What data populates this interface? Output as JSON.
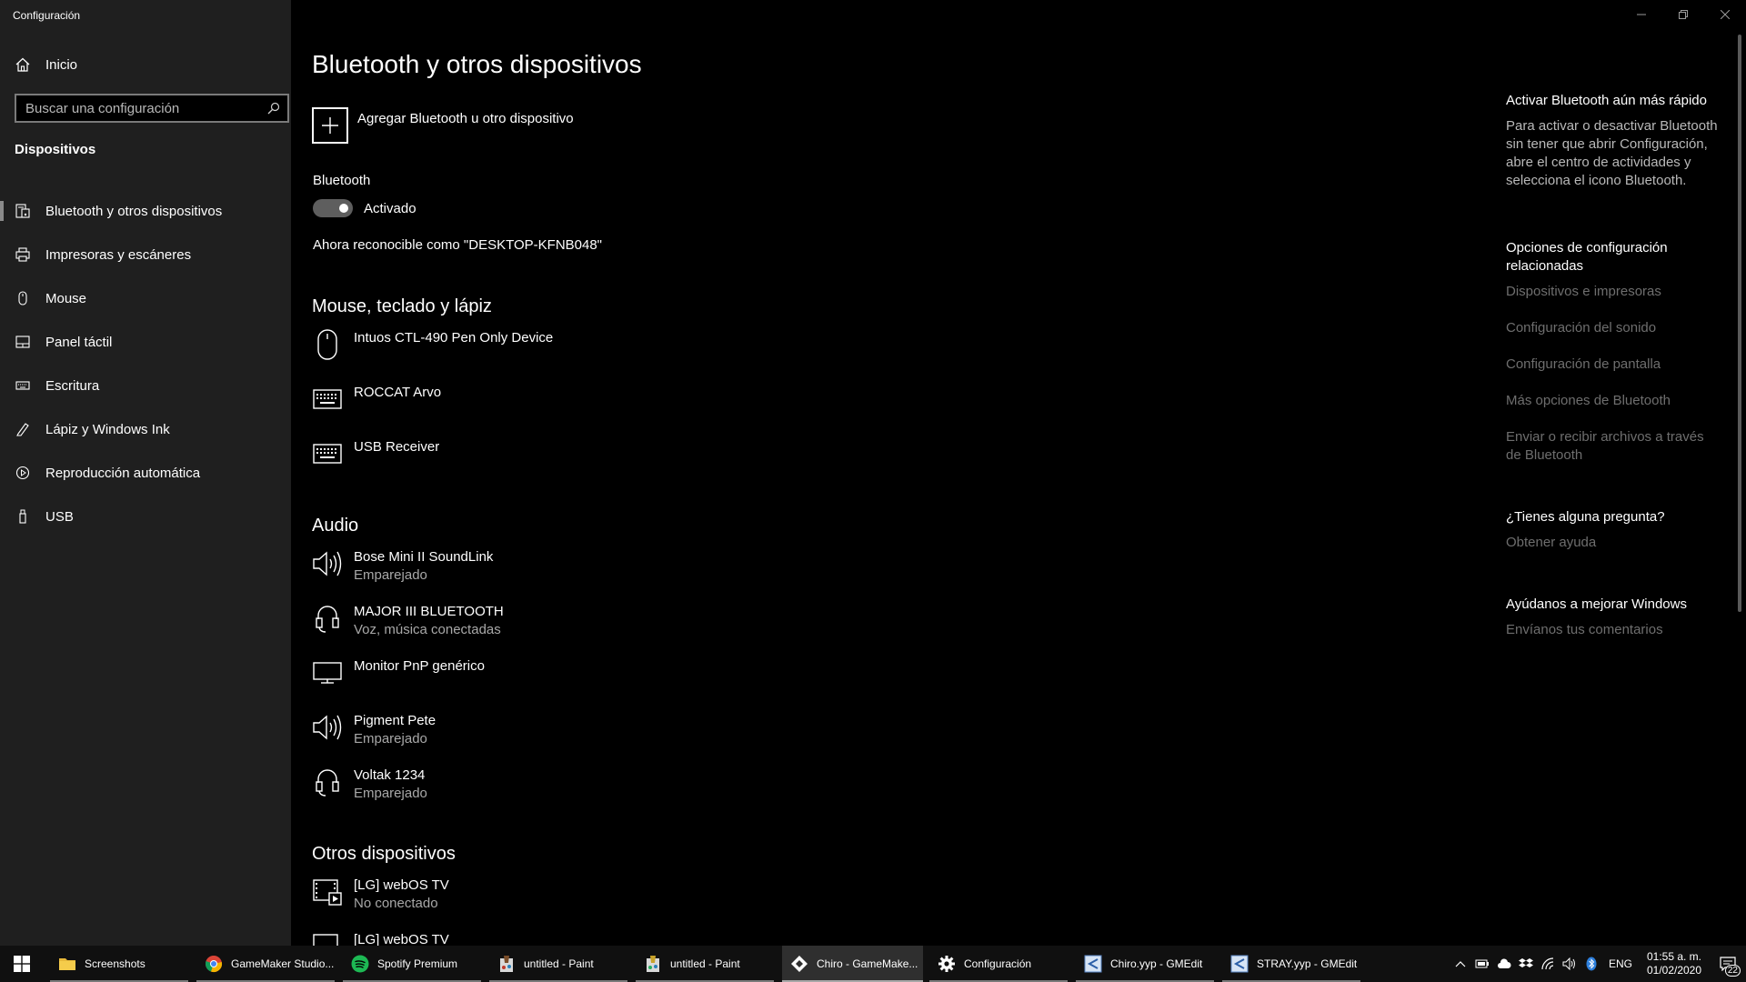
{
  "window": {
    "title": "Configuración"
  },
  "sidebar": {
    "home_label": "Inicio",
    "search_placeholder": "Buscar una configuración",
    "category": "Dispositivos",
    "items": [
      {
        "label": "Bluetooth y otros dispositivos",
        "icon": "bluetooth-devices-icon",
        "selected": true
      },
      {
        "label": "Impresoras y escáneres",
        "icon": "printer-icon"
      },
      {
        "label": "Mouse",
        "icon": "mouse-icon"
      },
      {
        "label": "Panel táctil",
        "icon": "touchpad-icon"
      },
      {
        "label": "Escritura",
        "icon": "keyboard-icon"
      },
      {
        "label": "Lápiz y Windows Ink",
        "icon": "pen-icon"
      },
      {
        "label": "Reproducción automática",
        "icon": "autoplay-icon"
      },
      {
        "label": "USB",
        "icon": "usb-icon"
      }
    ]
  },
  "main": {
    "title": "Bluetooth y otros dispositivos",
    "add_device_label": "Agregar Bluetooth u otro dispositivo",
    "bluetooth_label": "Bluetooth",
    "bluetooth_state": "Activado",
    "bluetooth_on": true,
    "discoverable_text": "Ahora reconocible como \"DESKTOP-KFNB048\"",
    "sections": {
      "input": {
        "heading": "Mouse, teclado y lápiz",
        "devices": [
          {
            "name": "Intuos CTL-490 Pen Only Device",
            "status": "",
            "icon": "mouse-icon"
          },
          {
            "name": "ROCCAT Arvo",
            "status": "",
            "icon": "keyboard-icon"
          },
          {
            "name": "USB Receiver",
            "status": "",
            "icon": "keyboard-icon"
          }
        ]
      },
      "audio": {
        "heading": "Audio",
        "devices": [
          {
            "name": "Bose Mini II SoundLink",
            "status": "Emparejado",
            "icon": "speaker-icon"
          },
          {
            "name": "MAJOR III BLUETOOTH",
            "status": "Voz, música conectadas",
            "icon": "headset-icon"
          },
          {
            "name": "Monitor PnP genérico",
            "status": "",
            "icon": "monitor-icon"
          },
          {
            "name": "Pigment Pete",
            "status": "Emparejado",
            "icon": "speaker-icon"
          },
          {
            "name": "Voltak 1234",
            "status": "Emparejado",
            "icon": "headset-icon"
          }
        ]
      },
      "other": {
        "heading": "Otros dispositivos",
        "devices": [
          {
            "name": "[LG] webOS TV",
            "status": "No conectado",
            "icon": "media-device-icon"
          },
          {
            "name": "[LG] webOS TV",
            "status": "",
            "icon": "media-device-icon"
          }
        ]
      }
    }
  },
  "right_pane": {
    "tip_heading": "Activar Bluetooth aún más rápido",
    "tip_text": "Para activar o desactivar Bluetooth sin tener que abrir Configuración, abre el centro de actividades y selecciona el icono Bluetooth.",
    "related_heading": "Opciones de configuración relacionadas",
    "related_links": [
      "Dispositivos e impresoras",
      "Configuración del sonido",
      "Configuración de pantalla",
      "Más opciones de Bluetooth",
      "Enviar o recibir archivos a través de Bluetooth"
    ],
    "question_heading": "¿Tienes alguna pregunta?",
    "help_link": "Obtener ayuda",
    "improve_heading": "Ayúdanos a mejorar Windows",
    "feedback_link": "Envíanos tus comentarios"
  },
  "taskbar": {
    "apps": [
      {
        "label": "Screenshots",
        "icon": "folder-icon"
      },
      {
        "label": "GameMaker Studio...",
        "icon": "chrome-icon"
      },
      {
        "label": "Spotify Premium",
        "icon": "spotify-icon"
      },
      {
        "label": "untitled - Paint",
        "icon": "paint-icon"
      },
      {
        "label": "untitled - Paint",
        "icon": "paint-icon"
      },
      {
        "label": "Chiro - GameMake...",
        "icon": "gamemaker-icon",
        "active": true
      },
      {
        "label": "Configuración",
        "icon": "gear-icon"
      },
      {
        "label": "Chiro.yyp - GMEdit",
        "icon": "gmedit-icon"
      },
      {
        "label": "STRAY.yyp - GMEdit",
        "icon": "gmedit-icon"
      }
    ],
    "language": "ENG",
    "time": "01:55 a. m.",
    "date": "01/02/2020",
    "notification_count": "22"
  },
  "colors": {
    "background": "#000000",
    "sidebar": "#1f1f1f",
    "link_muted": "#6e6e6e",
    "taskbar": "#101010"
  }
}
